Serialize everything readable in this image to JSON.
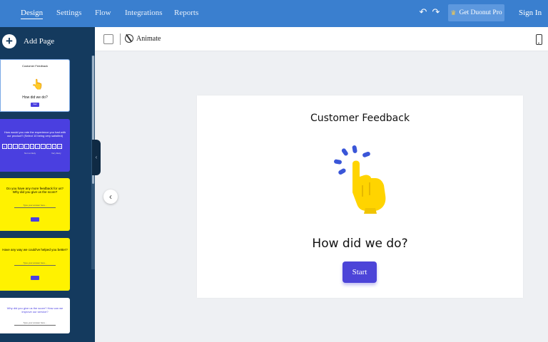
{
  "colors": {
    "topbar": "#3a7fcf",
    "sidebar": "#143a5e",
    "accent": "#4c44d8",
    "yellow": "#fff200"
  },
  "nav": {
    "tabs": [
      {
        "label": "Design",
        "active": true
      },
      {
        "label": "Settings"
      },
      {
        "label": "Flow"
      },
      {
        "label": "Integrations"
      },
      {
        "label": "Reports"
      }
    ],
    "undo_icon": "undo-icon",
    "redo_icon": "redo-icon",
    "pro_label": "Get Duonut Pro",
    "pro_icon": "crown-icon",
    "signin_label": "Sign In"
  },
  "sidebar": {
    "add_page_label": "Add Page",
    "thumbnails": [
      {
        "title": "Customer Feedback",
        "question": "How did we do?",
        "button": "Start"
      },
      {
        "text": "How would you rate the experience you had with our product? (Select 10 being very satisfied)",
        "low": "Not so likely",
        "high": "Very likely",
        "scale": [
          "0",
          "1",
          "2",
          "3",
          "4",
          "5",
          "6",
          "7",
          "8",
          "9",
          "10"
        ]
      },
      {
        "text": "Do you have any more feedback for us? Why did you give us the score?",
        "input": "Type your answer here..."
      },
      {
        "text": "Have any way we could've helped you better?",
        "input": "Type your answer here..."
      },
      {
        "text": "Why did you give us the score? How can we improve our service?",
        "input": "Type your answer here..."
      }
    ]
  },
  "toolbar": {
    "animate_label": "Animate",
    "animate_icon": "animate-icon",
    "mobile_icon": "mobile-preview-icon"
  },
  "card": {
    "title": "Customer Feedback",
    "question": "How did we do?",
    "start_label": "Start",
    "hand_icon": "pointing-hand-icon"
  }
}
